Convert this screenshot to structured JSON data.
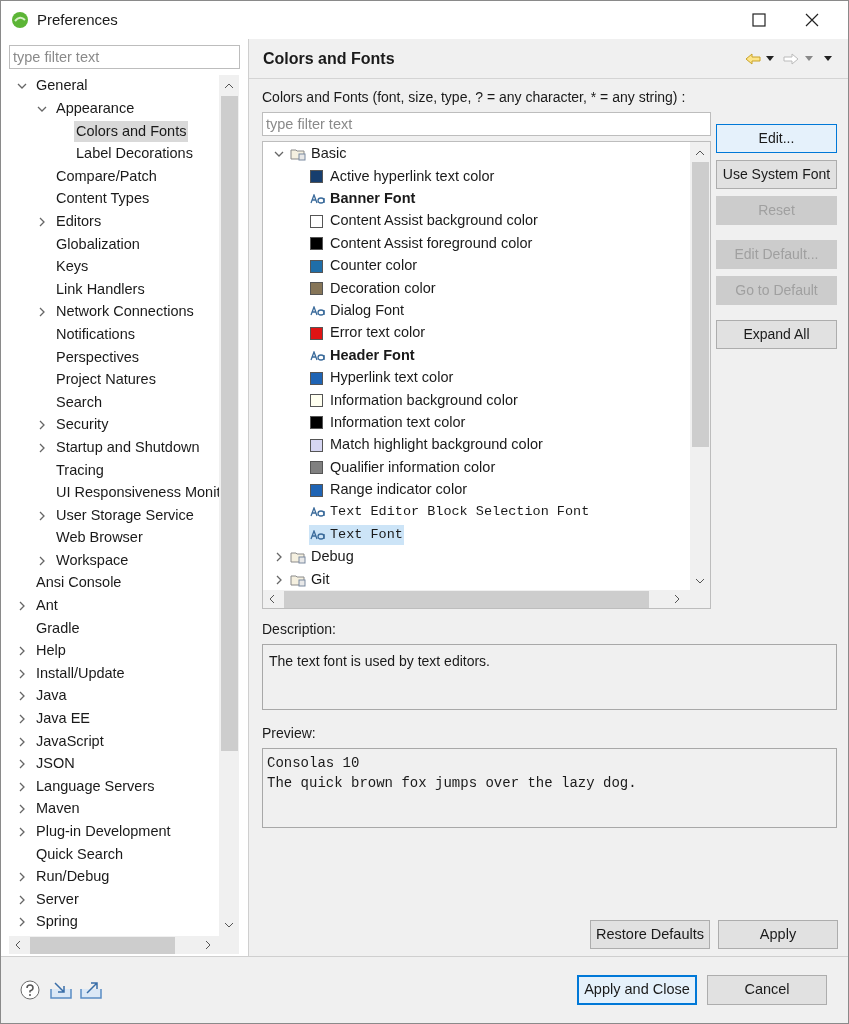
{
  "window": {
    "title": "Preferences"
  },
  "sidebar": {
    "filter": {
      "placeholder": "type filter text"
    },
    "tree": [
      {
        "label": "General",
        "expanded": true,
        "selected": false,
        "children": [
          {
            "label": "Appearance",
            "expanded": true,
            "selected": false,
            "children": [
              {
                "label": "Colors and Fonts",
                "selected": true
              },
              {
                "label": "Label Decorations",
                "selected": false
              }
            ]
          },
          {
            "label": "Compare/Patch",
            "selected": false
          },
          {
            "label": "Content Types",
            "selected": false
          },
          {
            "label": "Editors",
            "expanded": false,
            "selected": false
          },
          {
            "label": "Globalization",
            "selected": false
          },
          {
            "label": "Keys",
            "selected": false
          },
          {
            "label": "Link Handlers",
            "selected": false
          },
          {
            "label": "Network Connections",
            "expanded": false,
            "selected": false
          },
          {
            "label": "Notifications",
            "selected": false
          },
          {
            "label": "Perspectives",
            "selected": false
          },
          {
            "label": "Project Natures",
            "selected": false
          },
          {
            "label": "Search",
            "selected": false
          },
          {
            "label": "Security",
            "expanded": false,
            "selected": false
          },
          {
            "label": "Startup and Shutdown",
            "expanded": false,
            "selected": false
          },
          {
            "label": "Tracing",
            "selected": false
          },
          {
            "label": "UI Responsiveness Monit",
            "selected": false
          },
          {
            "label": "User Storage Service",
            "expanded": false,
            "selected": false
          },
          {
            "label": "Web Browser",
            "selected": false
          },
          {
            "label": "Workspace",
            "expanded": false,
            "selected": false
          }
        ]
      },
      {
        "label": "Ansi Console",
        "selected": false
      },
      {
        "label": "Ant",
        "expanded": false,
        "selected": false
      },
      {
        "label": "Gradle",
        "selected": false
      },
      {
        "label": "Help",
        "expanded": false,
        "selected": false
      },
      {
        "label": "Install/Update",
        "expanded": false,
        "selected": false
      },
      {
        "label": "Java",
        "expanded": false,
        "selected": false
      },
      {
        "label": "Java EE",
        "expanded": false,
        "selected": false
      },
      {
        "label": "JavaScript",
        "expanded": false,
        "selected": false
      },
      {
        "label": "JSON",
        "expanded": false,
        "selected": false
      },
      {
        "label": "Language Servers",
        "expanded": false,
        "selected": false
      },
      {
        "label": "Maven",
        "expanded": false,
        "selected": false
      },
      {
        "label": "Plug-in Development",
        "expanded": false,
        "selected": false
      },
      {
        "label": "Quick Search",
        "selected": false
      },
      {
        "label": "Run/Debug",
        "expanded": false,
        "selected": false
      },
      {
        "label": "Server",
        "expanded": false,
        "selected": false
      },
      {
        "label": "Spring",
        "expanded": false,
        "selected": false
      }
    ]
  },
  "page": {
    "title": "Colors and Fonts",
    "filter_label": "Colors and Fonts (font, size, type, ? = any character, * = any string) :",
    "filter": {
      "placeholder": "type filter text"
    },
    "categories": [
      {
        "label": "Basic",
        "expanded": true,
        "children": [
          {
            "label": "Active hyperlink text color",
            "kind": "color",
            "color": "#173e6e",
            "selected": false
          },
          {
            "label": "Banner Font",
            "kind": "bold-font",
            "selected": false
          },
          {
            "label": "Content Assist background color",
            "kind": "color",
            "color": "#ffffff",
            "selected": false
          },
          {
            "label": "Content Assist foreground color",
            "kind": "color",
            "color": "#000000",
            "selected": false
          },
          {
            "label": "Counter color",
            "kind": "color",
            "color": "#1f6ea8",
            "selected": false
          },
          {
            "label": "Decoration color",
            "kind": "color",
            "color": "#867558",
            "selected": false
          },
          {
            "label": "Dialog Font",
            "kind": "font",
            "selected": false
          },
          {
            "label": "Error text color",
            "kind": "color",
            "color": "#e01414",
            "selected": false
          },
          {
            "label": "Header Font",
            "kind": "bold-font",
            "selected": false
          },
          {
            "label": "Hyperlink text color",
            "kind": "color",
            "color": "#1f64b4",
            "selected": false
          },
          {
            "label": "Information background color",
            "kind": "color",
            "color": "#fffff0",
            "selected": false
          },
          {
            "label": "Information text color",
            "kind": "color",
            "color": "#000000",
            "selected": false
          },
          {
            "label": "Match highlight background color",
            "kind": "color",
            "color": "#d6d6f2",
            "selected": false
          },
          {
            "label": "Qualifier information color",
            "kind": "color",
            "color": "#808080",
            "selected": false
          },
          {
            "label": "Range indicator color",
            "kind": "color",
            "color": "#1f64b4",
            "selected": false
          },
          {
            "label": "Text Editor Block Selection Font",
            "kind": "mono-font",
            "selected": false
          },
          {
            "label": "Text Font",
            "kind": "mono-font",
            "selected": true
          }
        ]
      },
      {
        "label": "Debug",
        "expanded": false
      },
      {
        "label": "Git",
        "expanded": false
      }
    ],
    "side_buttons": [
      [
        {
          "label": "Edit...",
          "disabled": false,
          "focused": true
        },
        {
          "label": "Use System Font",
          "disabled": false,
          "focused": false
        },
        {
          "label": "Reset",
          "disabled": true,
          "focused": false
        }
      ],
      [
        {
          "label": "Edit Default...",
          "disabled": true,
          "focused": false
        },
        {
          "label": "Go to Default",
          "disabled": true,
          "focused": false
        }
      ],
      [
        {
          "label": "Expand All",
          "disabled": false,
          "focused": false
        }
      ]
    ],
    "description": {
      "label": "Description:",
      "text": "The text font is used by text editors."
    },
    "preview": {
      "label": "Preview:",
      "lines": [
        "Consolas 10",
        "The quick brown fox jumps over the lazy dog."
      ]
    },
    "page_buttons": [
      "Restore Defaults",
      "Apply"
    ]
  },
  "dialog_buttons": [
    {
      "label": "Apply and Close",
      "default": true
    },
    {
      "label": "Cancel",
      "default": false
    }
  ]
}
